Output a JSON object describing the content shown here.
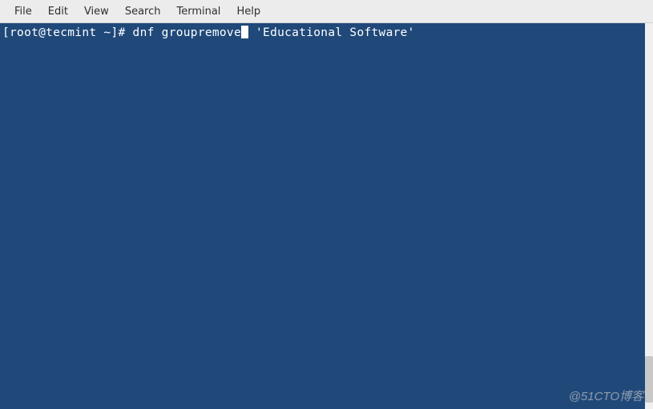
{
  "menubar": {
    "items": [
      {
        "label": "File"
      },
      {
        "label": "Edit"
      },
      {
        "label": "View"
      },
      {
        "label": "Search"
      },
      {
        "label": "Terminal"
      },
      {
        "label": "Help"
      }
    ]
  },
  "terminal": {
    "prompt": "[root@tecmint ~]# ",
    "command_part1": "dnf groupremove",
    "command_part2": " 'Educational Software'"
  },
  "watermark": "@51CTO博客"
}
